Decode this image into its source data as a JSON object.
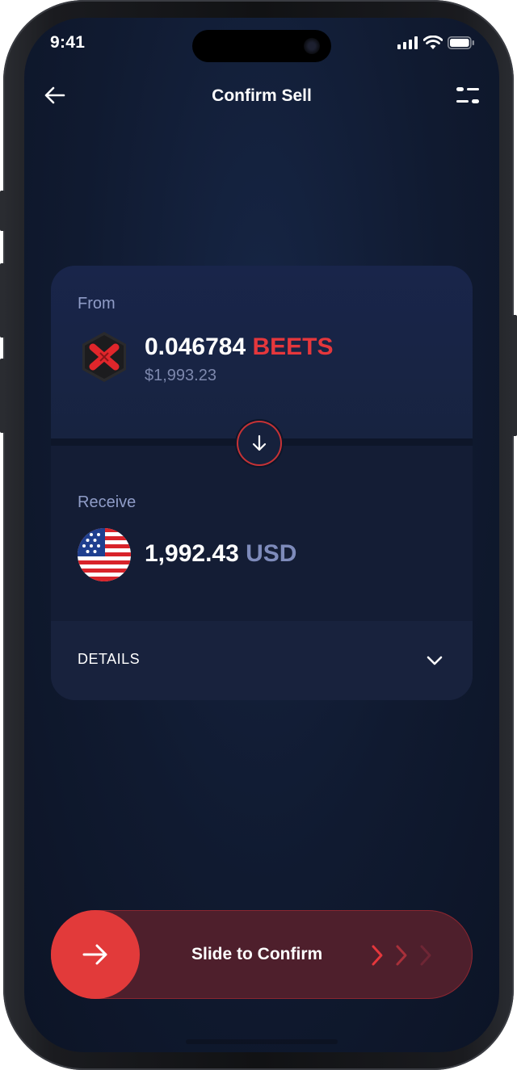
{
  "status_bar": {
    "time": "9:41"
  },
  "header": {
    "title": "Confirm Sell",
    "back_icon": "arrow-left-icon",
    "settings_icon": "sliders-icon"
  },
  "from": {
    "label": "From",
    "amount": "0.046784",
    "ticker": "BEETS",
    "fiat_value": "$1,993.23",
    "icon": "beets-token-icon"
  },
  "receive": {
    "label": "Receive",
    "amount": "1,992.43",
    "ticker": "USD",
    "icon": "us-flag-icon"
  },
  "details": {
    "label": "DETAILS"
  },
  "slider": {
    "label": "Slide to Confirm"
  },
  "colors": {
    "accent": "#e23a3a",
    "background": "#101a30",
    "muted_text": "#8f9cc7"
  }
}
